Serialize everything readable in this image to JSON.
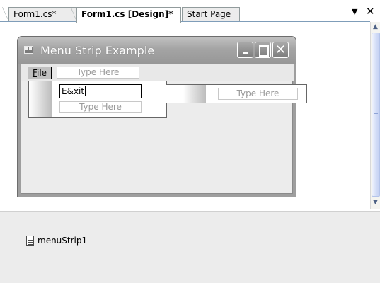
{
  "tabs": [
    {
      "label": "Form1.cs*",
      "active": false
    },
    {
      "label": "Form1.cs [Design]*",
      "active": true
    },
    {
      "label": "Start Page",
      "active": false
    }
  ],
  "tab_controls": {
    "dropdown_icon": "chevron-down-icon",
    "close_icon": "close-icon"
  },
  "form": {
    "title": "Menu Strip Example",
    "caption_buttons": [
      "minimize-icon",
      "maximize-icon",
      "close-icon"
    ]
  },
  "menustrip": {
    "file_prefix": "",
    "file_mnemonic": "F",
    "file_rest": "ile",
    "type_here": "Type Here"
  },
  "dropdown": {
    "editing_value": "E&xit",
    "type_here": "Type Here"
  },
  "submenu": {
    "type_here": "Type Here"
  },
  "tray": {
    "items": [
      {
        "label": "menuStrip1",
        "icon": "menustrip-icon"
      }
    ]
  },
  "colors": {
    "form_titlebar": "#a4a4a4",
    "menu_background": "#e8e8e8",
    "scrollbar_thumb": "#d6dff7"
  }
}
